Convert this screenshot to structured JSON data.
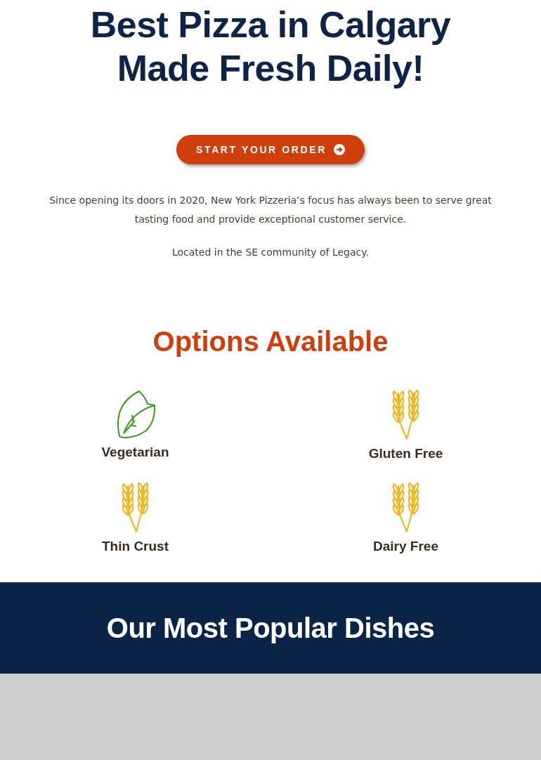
{
  "hero": {
    "title_lines": [
      "Best Pizza in Calgary",
      "Made Fresh Daily!"
    ],
    "order_button": {
      "label": "START YOUR ORDER"
    },
    "paragraphs": [
      "Since opening its doors in 2020, New York Pizzeria’s focus has always been to serve great tasting food and provide exceptional customer service.",
      "Located in the SE community of Legacy."
    ]
  },
  "options": {
    "title": "Options Available",
    "items": [
      {
        "kind": "leaf",
        "label": "Vegetarian"
      },
      {
        "kind": "wheat",
        "label": "Gluten Free"
      },
      {
        "kind": "wheat",
        "label": "Thin Crust"
      },
      {
        "kind": "wheat",
        "label": "Dairy Free"
      }
    ]
  },
  "popular": {
    "title": "Our Most Popular Dishes"
  }
}
